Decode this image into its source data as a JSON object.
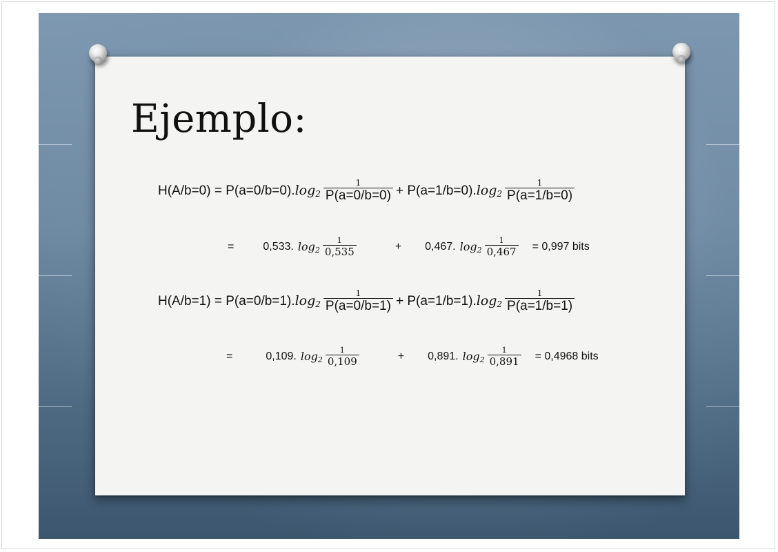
{
  "title": "Ejemplo:",
  "log_base": "log",
  "log_sub": "2",
  "one": "1",
  "eq1": {
    "lhs": "H(A/b=0) = P(a=0/b=0).",
    "den1": "P(a=0/b=0)",
    "mid": "+ P(a=1/b=0).",
    "den2": "P(a=1/b=0)"
  },
  "eq1_values": {
    "eq": "=",
    "coef1": "0,533.",
    "den1": "0,535",
    "plus": "+",
    "coef2": "0,467.",
    "den2": "0,467",
    "result": "= 0,997 bits"
  },
  "eq2": {
    "lhs": "H(A/b=1) = P(a=0/b=1).",
    "den1": "P(a=0/b=1)",
    "mid": "+ P(a=1/b=1).",
    "den2": "P(a=1/b=1)"
  },
  "eq2_values": {
    "eq": "=",
    "coef1": "0,109.",
    "den1": "0,109",
    "plus": "+",
    "coef2": "0,891.",
    "den2": "0,891",
    "result": "= 0,4968 bits"
  }
}
